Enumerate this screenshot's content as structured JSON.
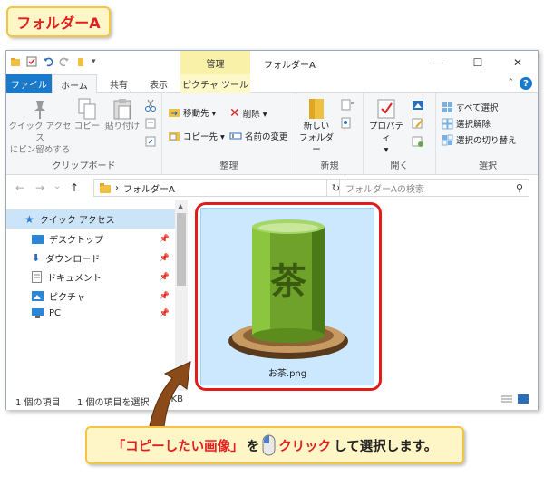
{
  "badge": {
    "title": "フォルダーA"
  },
  "window": {
    "context_tab": "管理",
    "title": "フォルダーA",
    "controls": {
      "minimize": "—",
      "maximize": "☐",
      "close": "✕"
    }
  },
  "tabs": {
    "file": "ファイル",
    "home": "ホーム",
    "share": "共有",
    "view": "表示",
    "picture_tools": "ピクチャ ツール"
  },
  "ribbon": {
    "clipboard": {
      "pin_line1": "クイック アクセス",
      "pin_line2": "にピン留めする",
      "copy": "コピー",
      "paste": "貼り付け",
      "label": "クリップボード"
    },
    "organize": {
      "move_to": "移動先 ▾",
      "copy_to": "コピー先 ▾",
      "delete": "削除 ▾",
      "rename": "名前の変更",
      "label": "整理"
    },
    "new": {
      "new_folder_line1": "新しい",
      "new_folder_line2": "フォルダー",
      "label": "新規"
    },
    "open": {
      "properties_line1": "プロパティ",
      "properties_line2": "▾",
      "label": "開く"
    },
    "select": {
      "select_all": "すべて選択",
      "select_none": "選択解除",
      "invert": "選択の切り替え",
      "label": "選択"
    }
  },
  "address": {
    "back": "←",
    "forward": "→",
    "recent": "⌄",
    "up": "↑",
    "path_sep": "›",
    "path": "フォルダーA",
    "refresh": "↻",
    "search_placeholder": "フォルダーAの検索"
  },
  "nav": {
    "items": [
      {
        "label": "クイック アクセス"
      },
      {
        "label": "デスクトップ"
      },
      {
        "label": "ダウンロード"
      },
      {
        "label": "ドキュメント"
      },
      {
        "label": "ピクチャ"
      },
      {
        "label": "PC"
      }
    ]
  },
  "file": {
    "name": "お茶.png",
    "icon_kanji": "茶"
  },
  "status": {
    "count": "1 個の項目",
    "selected": "1 個の項目を選択",
    "size": "9 KB"
  },
  "callout": {
    "part1": "「コピーしたい画像」",
    "part2": "を",
    "part3": "クリック",
    "part4": "して選択します。"
  }
}
